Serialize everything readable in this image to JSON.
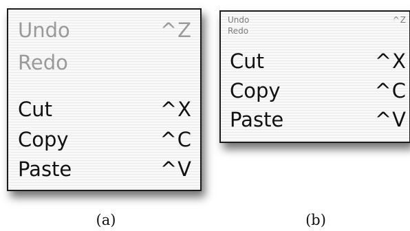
{
  "menu_a": {
    "items": [
      {
        "label": "Undo",
        "shortcut": "^Z",
        "enabled": false
      },
      {
        "label": "Redo",
        "shortcut": "",
        "enabled": false
      },
      {
        "label": "Cut",
        "shortcut": "^X",
        "enabled": true
      },
      {
        "label": "Copy",
        "shortcut": "^C",
        "enabled": true
      },
      {
        "label": "Paste",
        "shortcut": "^V",
        "enabled": true
      }
    ],
    "caption": "(a)"
  },
  "menu_b": {
    "items": [
      {
        "label": "Undo",
        "shortcut": "^Z",
        "enabled": false
      },
      {
        "label": "Redo",
        "shortcut": "",
        "enabled": false
      },
      {
        "label": "Cut",
        "shortcut": "^X",
        "enabled": true
      },
      {
        "label": "Copy",
        "shortcut": "^C",
        "enabled": true
      },
      {
        "label": "Paste",
        "shortcut": "^V",
        "enabled": true
      }
    ],
    "caption": "(b)"
  }
}
